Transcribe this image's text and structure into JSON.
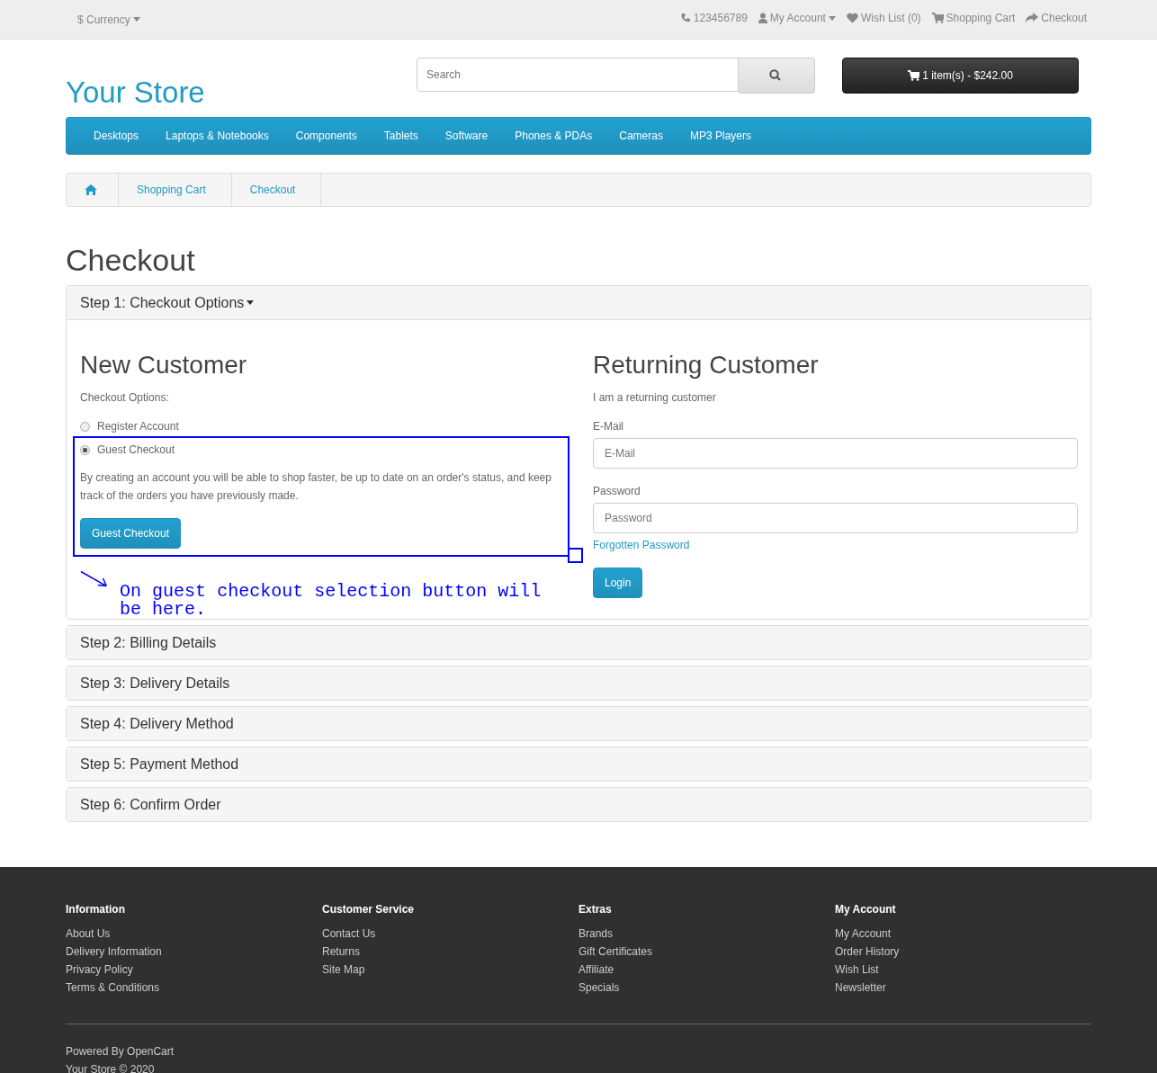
{
  "top_bar": {
    "currency": "$ Currency",
    "phone": "123456789",
    "links": [
      "My Account",
      "Wish List (0)",
      "Shopping Cart",
      "Checkout"
    ]
  },
  "header": {
    "logo": "Your Store",
    "search": {
      "placeholder": "Search"
    },
    "cart": "1 item(s) - $242.00"
  },
  "menu": [
    "Desktops",
    "Laptops & Notebooks",
    "Components",
    "Tablets",
    "Software",
    "Phones & PDAs",
    "Cameras",
    "MP3 Players"
  ],
  "breadcrumb": [
    "Shopping Cart",
    "Checkout"
  ],
  "title": "Checkout",
  "steps": [
    {
      "title": "Step 1: Checkout Options",
      "expanded": true
    },
    {
      "title": "Step 2: Billing Details",
      "expanded": false
    },
    {
      "title": "Step 3: Delivery Details",
      "expanded": false
    },
    {
      "title": "Step 4: Delivery Method",
      "expanded": false
    },
    {
      "title": "Step 5: Payment Method",
      "expanded": false
    },
    {
      "title": "Step 6: Confirm Order",
      "expanded": false
    }
  ],
  "new_customer": {
    "heading": "New Customer",
    "label": "Checkout Options:",
    "options": [
      {
        "label": "Register Account",
        "selected": false
      },
      {
        "label": "Guest Checkout",
        "selected": true
      }
    ],
    "description": "By creating an account you will be able to shop faster, be up to date on an order's status, and keep track of the orders you have previously made.",
    "button": "Guest Checkout"
  },
  "returning_customer": {
    "heading": "Returning Customer",
    "intro": "I am a returning customer",
    "email": {
      "label": "E-Mail",
      "placeholder": "E-Mail"
    },
    "password": {
      "label": "Password",
      "placeholder": "Password"
    },
    "forgot": "Forgotten Password",
    "button": "Login"
  },
  "annotation": {
    "text": "On guest checkout selection button will be here."
  },
  "footer": {
    "columns": [
      {
        "heading": "Information",
        "links": [
          "About Us",
          "Delivery Information",
          "Privacy Policy",
          "Terms & Conditions"
        ]
      },
      {
        "heading": "Customer Service",
        "links": [
          "Contact Us",
          "Returns",
          "Site Map"
        ]
      },
      {
        "heading": "Extras",
        "links": [
          "Brands",
          "Gift Certificates",
          "Affiliate",
          "Specials"
        ]
      },
      {
        "heading": "My Account",
        "links": [
          "My Account",
          "Order History",
          "Wish List",
          "Newsletter"
        ]
      }
    ],
    "powered_by": "Powered By",
    "powered_link": "OpenCart",
    "copyright": "Your Store © 2020"
  }
}
